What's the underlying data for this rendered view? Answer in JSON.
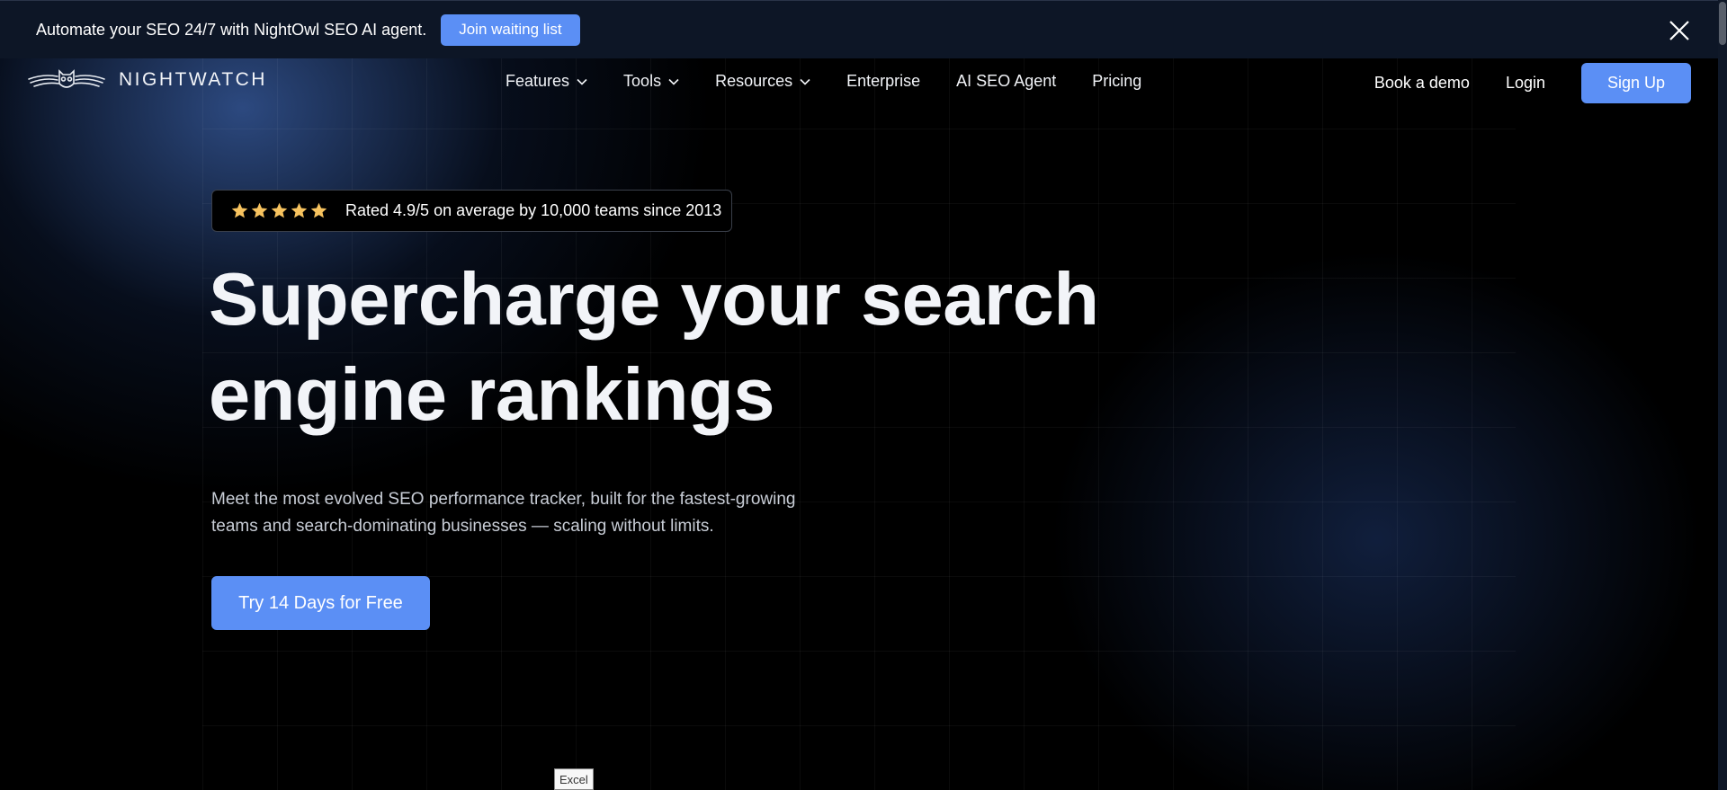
{
  "announcement": {
    "text": "Automate your SEO 24/7 with NightOwl SEO AI agent.",
    "button_label": "Join waiting list",
    "close_icon": "close-icon"
  },
  "nav": {
    "logo_text": "NIGHTWATCH",
    "logo_icon": "owl-wings-logo",
    "items": [
      {
        "label": "Features",
        "has_dropdown": true
      },
      {
        "label": "Tools",
        "has_dropdown": true
      },
      {
        "label": "Resources",
        "has_dropdown": true
      },
      {
        "label": "Enterprise",
        "has_dropdown": false
      },
      {
        "label": "AI SEO Agent",
        "has_dropdown": false
      },
      {
        "label": "Pricing",
        "has_dropdown": false
      }
    ],
    "book_demo": "Book a demo",
    "login": "Login",
    "signup": "Sign Up"
  },
  "hero": {
    "rating_stars": 5,
    "rating_text": "Rated 4.9/5 on average by 10,000 teams since 2013",
    "title_line1": "Supercharge your search",
    "title_line2": "engine rankings",
    "subtitle_line1": "Meet the most evolved SEO performance tracker, built for the fastest-growing",
    "subtitle_line2": "teams and search-dominating businesses — scaling without limits.",
    "cta_label": "Try 14 Days for Free"
  },
  "tooltip": {
    "text": "Excel"
  },
  "colors": {
    "accent": "#5b8ff5",
    "announcement_bg": "#0d1626",
    "star": "#f7c35f",
    "background": "#000000"
  }
}
